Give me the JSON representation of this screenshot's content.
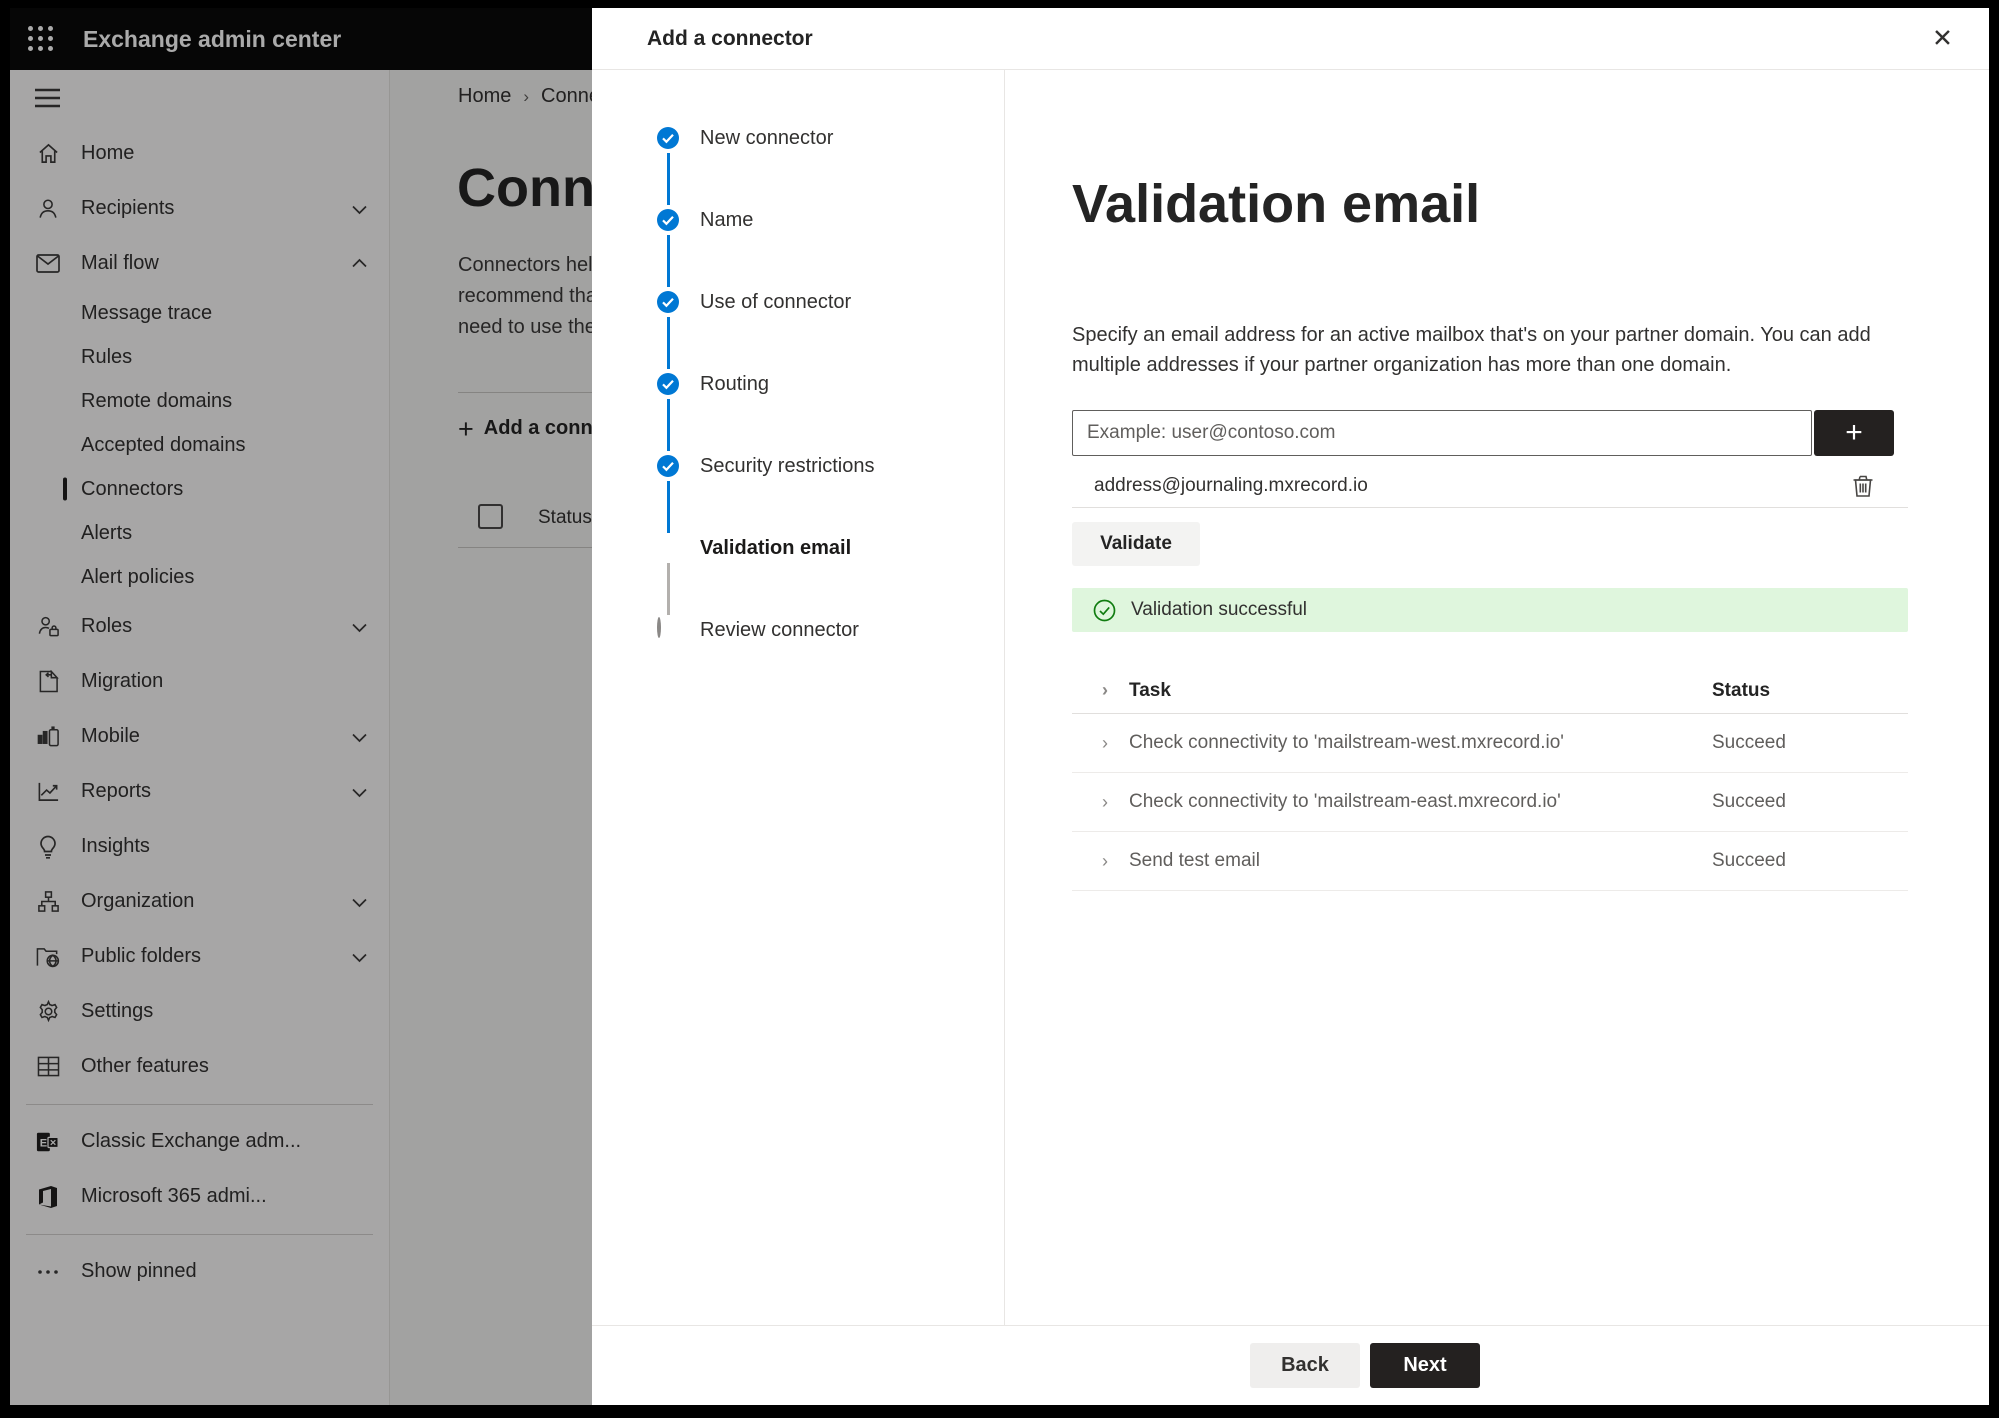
{
  "topbar": {
    "title": "Exchange admin center"
  },
  "sidebar": {
    "items": [
      {
        "label": "Home"
      },
      {
        "label": "Recipients"
      },
      {
        "label": "Mail flow"
      },
      {
        "label": "Message trace"
      },
      {
        "label": "Rules"
      },
      {
        "label": "Remote domains"
      },
      {
        "label": "Accepted domains"
      },
      {
        "label": "Connectors"
      },
      {
        "label": "Alerts"
      },
      {
        "label": "Alert policies"
      },
      {
        "label": "Roles"
      },
      {
        "label": "Migration"
      },
      {
        "label": "Mobile"
      },
      {
        "label": "Reports"
      },
      {
        "label": "Insights"
      },
      {
        "label": "Organization"
      },
      {
        "label": "Public folders"
      },
      {
        "label": "Settings"
      },
      {
        "label": "Other features"
      },
      {
        "label": "Classic Exchange adm..."
      },
      {
        "label": "Microsoft 365 admi..."
      },
      {
        "label": "Show pinned"
      }
    ]
  },
  "background_page": {
    "breadcrumb": {
      "home": "Home",
      "current": "Conne"
    },
    "title": "Connec",
    "paragraph_lines": [
      "Connectors help",
      "recommend tha",
      "need to use ther"
    ],
    "add_button": "Add a conn",
    "status_header": "Status"
  },
  "panel": {
    "title": "Add a connector",
    "close_label": "✕",
    "steps": [
      {
        "label": "New connector",
        "state": "completed"
      },
      {
        "label": "Name",
        "state": "completed"
      },
      {
        "label": "Use of connector",
        "state": "completed"
      },
      {
        "label": "Routing",
        "state": "completed"
      },
      {
        "label": "Security restrictions",
        "state": "completed"
      },
      {
        "label": "Validation email",
        "state": "current"
      },
      {
        "label": "Review connector",
        "state": "upcoming"
      }
    ],
    "content": {
      "heading": "Validation email",
      "description": "Specify an email address for an active mailbox that's on your partner domain. You can add multiple addresses if your partner organization has more than one domain.",
      "email_placeholder": "Example: user@contoso.com",
      "address": "address@journaling.mxrecord.io",
      "validate_button": "Validate",
      "banner_text": "Validation successful",
      "table": {
        "header_task": "Task",
        "header_status": "Status",
        "rows": [
          {
            "task": "Check connectivity to 'mailstream-west.mxrecord.io'",
            "status": "Succeed"
          },
          {
            "task": "Check connectivity to 'mailstream-east.mxrecord.io'",
            "status": "Succeed"
          },
          {
            "task": "Send test email",
            "status": "Succeed"
          }
        ]
      }
    },
    "footer": {
      "back": "Back",
      "next": "Next"
    }
  },
  "colors": {
    "accent": "#0078d4",
    "success_bg": "#dff6dd",
    "success_icon": "#107c10",
    "dark_button": "#242120"
  }
}
